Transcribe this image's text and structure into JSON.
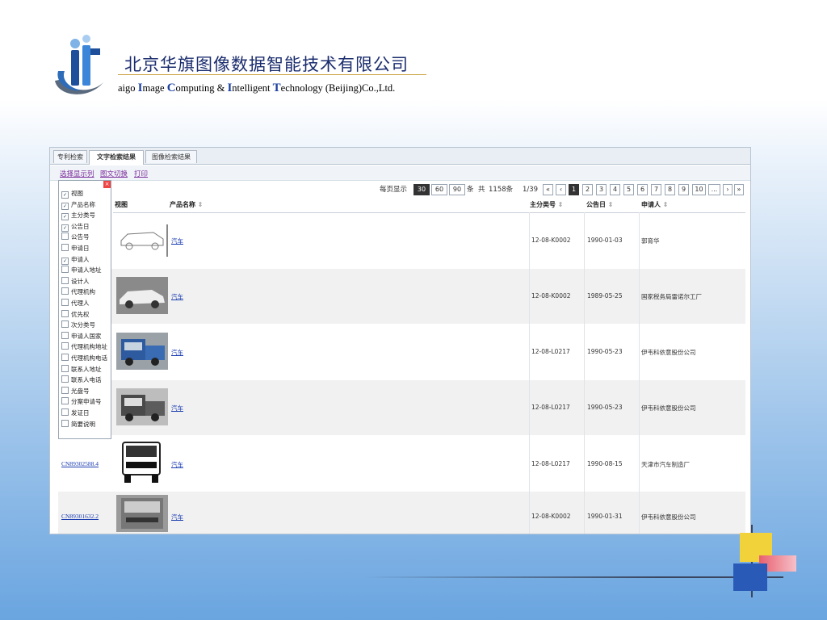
{
  "company": {
    "name_cn": "北京华旗图像数据智能技术有限公司",
    "name_en_parts": [
      "aigo ",
      "I",
      "mage ",
      "C",
      "omputing & ",
      "I",
      "ntelligent ",
      "T",
      "echnology (Beijing)Co.,Ltd."
    ]
  },
  "tabs": [
    "专利检索",
    "文字检索结果",
    "图像检索结果"
  ],
  "toolbar": [
    "选择显示列",
    "图文切换",
    "打印"
  ],
  "pager": {
    "per_page_label": "每页显示",
    "sizes": [
      "30",
      "60",
      "90"
    ],
    "unit": "条",
    "total_prefix": "共",
    "total": "1158条",
    "page_info": "1/39",
    "first": "«",
    "prev": "‹",
    "pages": [
      "1",
      "2",
      "3",
      "4",
      "5",
      "6",
      "7",
      "8",
      "9",
      "10",
      "..."
    ],
    "next": "›",
    "last": "»"
  },
  "columns_panel": {
    "close": "×",
    "items": [
      {
        "label": "视图",
        "checked": true
      },
      {
        "label": "产品名称",
        "checked": true
      },
      {
        "label": "主分类号",
        "checked": true
      },
      {
        "label": "公告日",
        "checked": true
      },
      {
        "label": "公告号",
        "checked": false
      },
      {
        "label": "申请日",
        "checked": false
      },
      {
        "label": "申请人",
        "checked": true
      },
      {
        "label": "申请人地址",
        "checked": false
      },
      {
        "label": "设计人",
        "checked": false
      },
      {
        "label": "代理机构",
        "checked": false
      },
      {
        "label": "代理人",
        "checked": false
      },
      {
        "label": "优先权",
        "checked": false
      },
      {
        "label": "次分类号",
        "checked": false
      },
      {
        "label": "申请人国家",
        "checked": false
      },
      {
        "label": "代理机构地址",
        "checked": false
      },
      {
        "label": "代理机构电话",
        "checked": false
      },
      {
        "label": "联系人地址",
        "checked": false
      },
      {
        "label": "联系人电话",
        "checked": false
      },
      {
        "label": "光盘号",
        "checked": false
      },
      {
        "label": "分案申请号",
        "checked": false
      },
      {
        "label": "发证日",
        "checked": false
      },
      {
        "label": "简要说明",
        "checked": false
      }
    ]
  },
  "table": {
    "headers": {
      "view": "视图",
      "name": "产品名称",
      "class": "主分类号",
      "date": "公告日",
      "applicant": "申请人"
    },
    "sort_icon": "⇕",
    "rows": [
      {
        "id": "",
        "name": "汽车",
        "class": "12-08-K0002",
        "date": "1990-01-03",
        "applicant": "郭育华"
      },
      {
        "id": "",
        "name": "汽车",
        "class": "12-08-K0002",
        "date": "1989-05-25",
        "applicant": "国家税务局雷诺尔工厂"
      },
      {
        "id": "",
        "name": "汽车",
        "class": "12-08-L0217",
        "date": "1990-05-23",
        "applicant": "伊韦科依意股份公司"
      },
      {
        "id": "",
        "name": "汽车",
        "class": "12-08-L0217",
        "date": "1990-05-23",
        "applicant": "伊韦科依意股份公司"
      },
      {
        "id": "CN89302588.4",
        "name": "汽车",
        "class": "12-08-L0217",
        "date": "1990-08-15",
        "applicant": "天津市汽车制造厂"
      },
      {
        "id": "CN89301632.2",
        "name": "汽车",
        "class": "12-08-K0002",
        "date": "1990-01-31",
        "applicant": "伊韦科依意股份公司"
      }
    ]
  },
  "colors": {
    "title": "#1a2c6e",
    "link": "#1a3cb0",
    "accent_gold": "#c9a23e"
  }
}
